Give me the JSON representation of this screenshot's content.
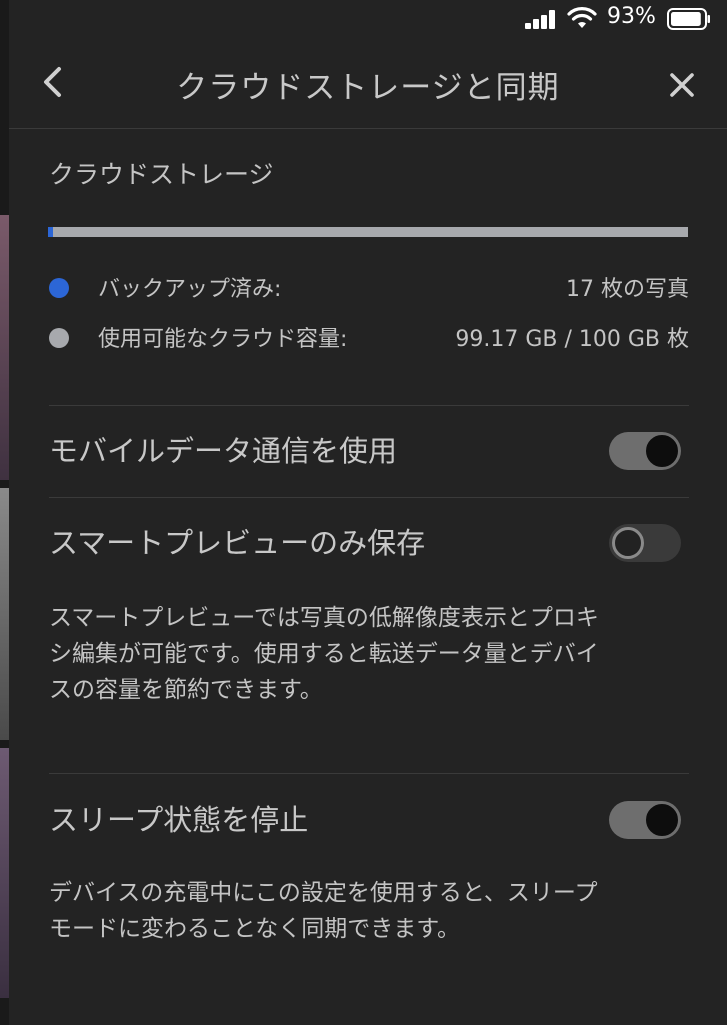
{
  "status_bar": {
    "battery_percent": "93%",
    "battery_level": 0.93
  },
  "header": {
    "title": "クラウドストレージと同期",
    "back_icon": "chevron-left-icon",
    "close_icon": "close-icon"
  },
  "storage": {
    "section_title": "クラウドストレージ",
    "usage_fraction": 0.0083,
    "backed_up_label": "バックアップ済み:",
    "backed_up_value": "17 枚の写真",
    "available_label": "使用可能なクラウド容量:",
    "available_value": "99.17 GB / 100 GB 枚"
  },
  "settings": {
    "mobile_data": {
      "label": "モバイルデータ通信を使用",
      "enabled": true
    },
    "smart_preview": {
      "label": "スマートプレビューのみ保存",
      "enabled": false,
      "description_line1": "スマートプレビューでは写真の低解像度表示とプロキ",
      "description_line2": "シ編集が可能です。使用すると転送データ量とデバイ",
      "description_line3": "スの容量を節約できます。"
    },
    "prevent_sleep": {
      "label": "スリープ状態を停止",
      "enabled": true,
      "description_line1": "デバイスの充電中にこの設定を使用すると、スリープ",
      "description_line2": "モードに変わることなく同期できます。"
    }
  },
  "colors": {
    "background": "#232323",
    "accent_blue": "#2c66d6",
    "available_gray": "#a7a9ad"
  }
}
